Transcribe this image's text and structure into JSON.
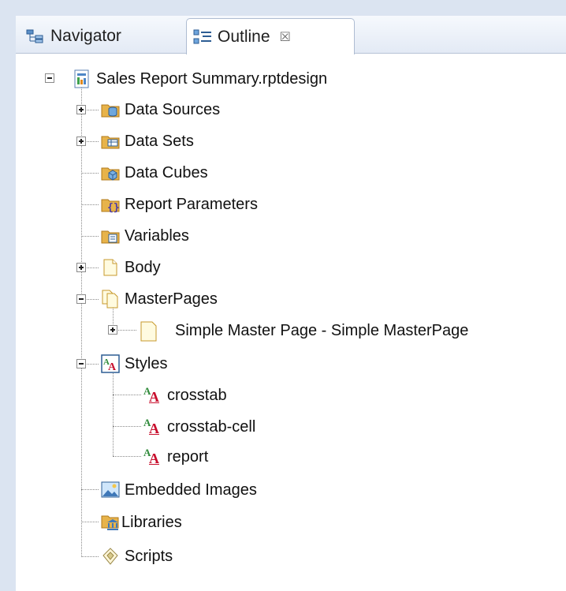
{
  "tabs": [
    {
      "label": "Navigator",
      "icon": "navigator-icon",
      "active": false
    },
    {
      "label": "Outline",
      "icon": "outline-icon",
      "active": true,
      "close": "☒"
    }
  ],
  "tree": {
    "root": "Sales Report Summary.rptdesign",
    "data_sources": "Data Sources",
    "data_sets": "Data Sets",
    "data_cubes": "Data Cubes",
    "report_parameters": "Report Parameters",
    "variables": "Variables",
    "body": "Body",
    "master_pages": "MasterPages",
    "simple_master_page": "Simple Master Page - Simple MasterPage",
    "styles": "Styles",
    "style_items": [
      "crosstab",
      "crosstab-cell",
      "report"
    ],
    "embedded_images": "Embedded Images",
    "libraries": "Libraries",
    "scripts": "Scripts"
  },
  "colors": {
    "background": "#dbe4f1",
    "folder": "#e7b34a",
    "style_green": "#2f8a3a",
    "style_red": "#c8102e"
  }
}
